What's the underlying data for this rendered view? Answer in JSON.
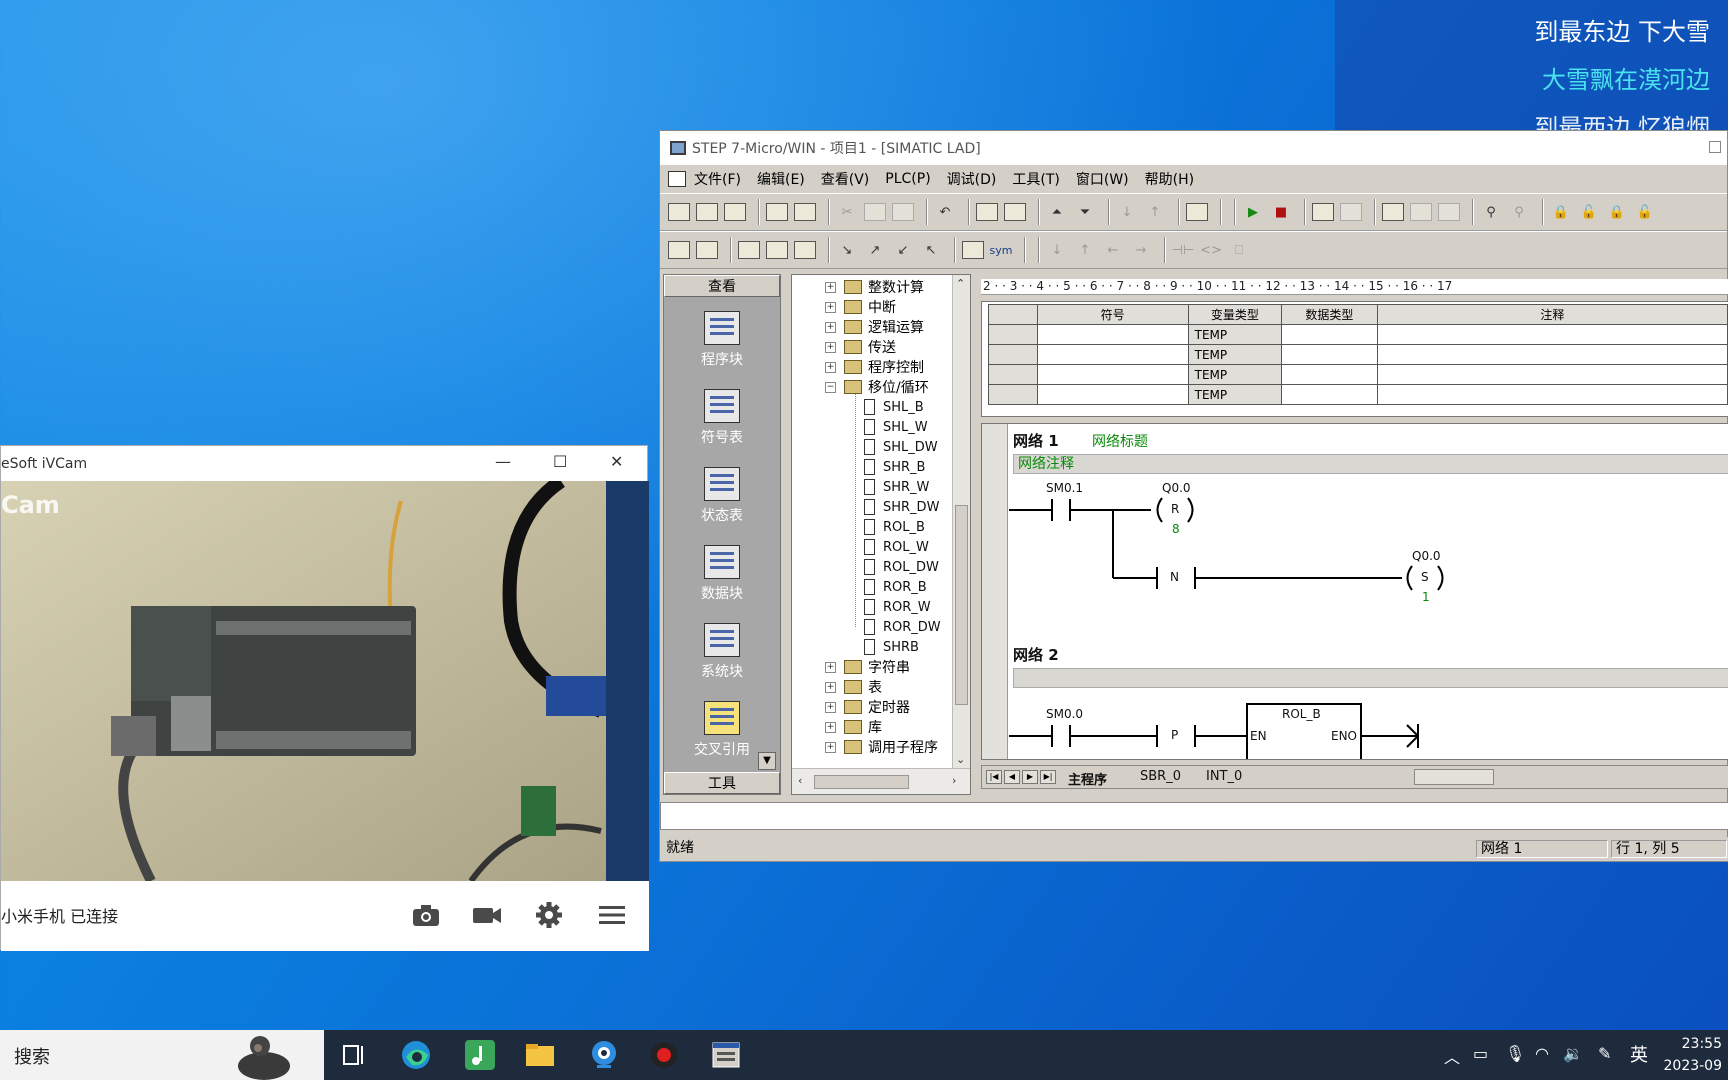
{
  "lyrics": {
    "line1": "到最东边 下大雪",
    "line2": "大雪飘在漠河边",
    "line3": "到最西边 忆狼烟"
  },
  "step7": {
    "title": "STEP 7-Micro/WIN - 项目1 - [SIMATIC LAD]",
    "menu": [
      "文件(F)",
      "编辑(E)",
      "查看(V)",
      "PLC(P)",
      "调试(D)",
      "工具(T)",
      "窗口(W)",
      "帮助(H)"
    ],
    "toolbar_sym": "sym",
    "nav": {
      "header": "查看",
      "footer": "工具",
      "items": [
        "程序块",
        "符号表",
        "状态表",
        "数据块",
        "系统块",
        "交叉引用"
      ]
    },
    "tree": {
      "folders_top": [
        "整数计算",
        "中断",
        "逻辑运算",
        "传送",
        "程序控制",
        "移位/循环"
      ],
      "leaves": [
        "SHL_B",
        "SHL_W",
        "SHL_DW",
        "SHR_B",
        "SHR_W",
        "SHR_DW",
        "ROL_B",
        "ROL_W",
        "ROL_DW",
        "ROR_B",
        "ROR_W",
        "ROR_DW",
        "SHRB"
      ],
      "folders_bottom": [
        "字符串",
        "表",
        "定时器",
        "库",
        "调用子程序"
      ]
    },
    "ruler": "2 · · 3 · · 4 · · 5 · · 6 · · 7 · · 8 · · 9 · · 10 · · 11 · · 12 · · 13 · · 14 · · 15 · · 16 · · 17",
    "var_table": {
      "headers": [
        "符号",
        "变量类型",
        "数据类型",
        "注释"
      ],
      "rows": [
        "TEMP",
        "TEMP",
        "TEMP",
        "TEMP"
      ]
    },
    "ladder": {
      "network1_label": "网络 1",
      "network1_title": "网络标题",
      "network1_comment": "网络注释",
      "sm01": "SM0.1",
      "coil1_addr": "Q0.0",
      "coil1_op": "R",
      "coil1_n": "8",
      "n_contact": "N",
      "coil2_addr": "Q0.0",
      "coil2_op": "S",
      "coil2_n": "1",
      "network2_label": "网络 2",
      "sm00": "SM0.0",
      "p_contact": "P",
      "box_name": "ROL_B",
      "box_en": "EN",
      "box_eno": "ENO"
    },
    "tabs": [
      "主程序",
      "SBR_0",
      "INT_0"
    ],
    "status": {
      "ready": "就绪",
      "network": "网络 1",
      "position": "行 1, 列 5"
    }
  },
  "ivcam": {
    "title": "eSoft iVCam",
    "watermark": "Cam",
    "status": "小米手机 已连接"
  },
  "taskbar": {
    "search": "搜索",
    "ime": "英",
    "time": "23:55",
    "date": "2023-09"
  }
}
